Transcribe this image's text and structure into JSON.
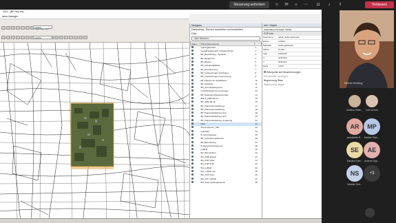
{
  "meeting": {
    "share_button_label": "Steuerung anfordern",
    "leave_button_label": "Verlassen",
    "presenter_name": "Michel Hertling",
    "participants": [
      {
        "name": "Bettina Hölle...",
        "initials": "",
        "color": "#c9b49a",
        "photo": true
      },
      {
        "name": "Kira Urban",
        "initials": "",
        "color": "#d8c3b0",
        "photo": true
      },
      {
        "name": "Annabelle R...",
        "initials": "AR",
        "color": "#e2a9a0",
        "photo": false
      },
      {
        "name": "Malthe Park...",
        "initials": "MP",
        "color": "#b6c9e6",
        "photo": false
      },
      {
        "name": "Sandra Edel...",
        "initials": "SE",
        "color": "#ead9a4",
        "photo": false
      },
      {
        "name": "Andrea Epp...",
        "initials": "AE",
        "color": "#e3b0b0",
        "photo": false
      },
      {
        "name": "Ninette Sch...",
        "initials": "NS",
        "color": "#c5d2ea",
        "photo": false
      }
    ],
    "more_label": "+3"
  },
  "app": {
    "window_title": "2021 - [BP Ned.ine]",
    "menu_title": "tation Manager",
    "combo_1": "Luftbild",
    "combo_2": "Luftbild",
    "layers_panel": {
      "title": "Navigator",
      "display_label": "Darstellung - Ebenen auswählen und bearbeiten",
      "filter_label": "Filter",
      "filter_value": "<Alle Ebenen>",
      "column_status": "Status",
      "column_name": "Planzeichenebenen",
      "rows": [
        {
          "name": "Geltungsbereich",
          "num": "1",
          "sel": false
        },
        {
          "name": "Gestaltungsbereich Vorhabenbezen",
          "num": "2",
          "sel": false
        },
        {
          "name": "BP_Beschriftung - Symbole",
          "num": "3",
          "sel": false
        },
        {
          "name": "BP_Baugrenze",
          "num": "4",
          "sel": false
        },
        {
          "name": "BP_Baume",
          "num": "5",
          "sel": false
        },
        {
          "name": "BP_Gebaeudefläche",
          "num": "6",
          "sel": false
        },
        {
          "name": "BP_Erschliessung",
          "num": "7",
          "sel": false
        },
        {
          "name": "BP_Festsetzungen Grünflugen",
          "num": "8",
          "sel": false
        },
        {
          "name": "BP_Festsetzungen Grünordnung",
          "num": "9",
          "sel": false
        },
        {
          "name": "BP_Flächen für Gehrflächen",
          "num": "10",
          "sel": false
        },
        {
          "name": "BP_Gebäude",
          "num": "11",
          "sel": false
        },
        {
          "name": "BP_Grundstücksgrenze",
          "num": "12",
          "sel": false
        },
        {
          "name": "Grundstückgrenzen Leitungen",
          "num": "13",
          "sel": false
        },
        {
          "name": "BP_Naturschutzfestsetzungen",
          "num": "14",
          "sel": false
        },
        {
          "name": "BPNT_2020-03-10",
          "num": "15",
          "sel": false
        },
        {
          "name": "BP_2020-03-10",
          "num": "16",
          "sel": false
        },
        {
          "name": "BP_Planzeichenerklärung",
          "num": "17",
          "sel": false
        },
        {
          "name": "BP_Planzeichenerklärung",
          "num": "18",
          "sel": false
        },
        {
          "name": "BP_Planwerkerklärung Geh",
          "num": "19",
          "sel": false
        },
        {
          "name": "BP_Planwerkerklärung Geh",
          "num": "20",
          "sel": false
        },
        {
          "name": "BP_Planwerkerklärung umgebung",
          "num": "21",
          "sel": false
        },
        {
          "name": "Hilfe",
          "num": "22",
          "sel": true
        },
        {
          "name": "Stummebenen_Hilfe",
          "num": "23",
          "sel": false
        },
        {
          "name": "Gebäude",
          "num": "24",
          "sel": false
        },
        {
          "name": "B_Schutzgebiete",
          "num": "25",
          "sel": false
        },
        {
          "name": "BP_Festsetzungsbereich",
          "num": "26",
          "sel": false
        },
        {
          "name": "BP_Beschriftung",
          "num": "27",
          "sel": false
        },
        {
          "name": "B_Raumbereichsgrenze",
          "num": "28",
          "sel": false
        },
        {
          "name": "Luftbild",
          "num": "29",
          "sel": false
        },
        {
          "name": "BG_Baumreihen",
          "num": "30",
          "sel": false
        },
        {
          "name": "BG_FMP aktuell",
          "num": "31",
          "sel": false
        },
        {
          "name": "BG_FNP Gitter",
          "num": "32",
          "sel": false
        },
        {
          "name": "BG_FNP Scan",
          "num": "33",
          "sel": false
        },
        {
          "name": "BG_Luftbild",
          "num": "34",
          "sel": false
        },
        {
          "name": "BG_Luftbild neu",
          "num": "35",
          "sel": false
        },
        {
          "name": "BG_TOP Scan",
          "num": "36",
          "sel": false
        },
        {
          "name": "BG_DTK Tiefbau",
          "num": "37",
          "sel": false
        },
        {
          "name": "BG_Scan Geltungsbereich",
          "num": "38",
          "sel": false
        }
      ]
    },
    "props_panel": {
      "title": "Info / Objekt",
      "tabs": [
        "Objekt",
        "Bereiche",
        "Daten",
        "Tabelle"
      ],
      "section": "FOP-Info",
      "rows": [
        {
          "label": "Dateiname",
          "value": "Inhalt_Geltungsbereich"
        },
        {
          "label": "Ebene",
          "value": "Luftbild"
        },
        {
          "label": "Maßstab",
          "value": "Geltungsbereich"
        },
        {
          "label": "Fläche",
          "value": "51.367"
        },
        {
          "label": "Verh.",
          "value": "1000,000"
        },
        {
          "label": "X",
          "value": "4436,961"
        },
        {
          "label": "Y",
          "value": "5246,921"
        },
        {
          "label": "Höhe",
          "value": "3,000"
        }
      ],
      "note_1": "Stützpunkt auf Neuzeichnungen",
      "note_2": "Konstruktion anzeigen",
      "note_3": "Begrenzung Stam",
      "note_4": "Begrenzung zeigen"
    }
  }
}
